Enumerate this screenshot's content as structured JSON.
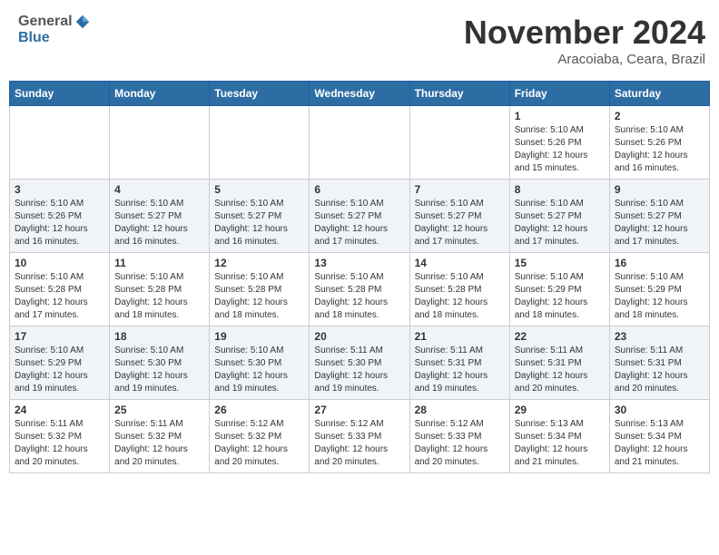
{
  "header": {
    "logo_general": "General",
    "logo_blue": "Blue",
    "month_title": "November 2024",
    "location": "Aracoiaba, Ceara, Brazil"
  },
  "weekdays": [
    "Sunday",
    "Monday",
    "Tuesday",
    "Wednesday",
    "Thursday",
    "Friday",
    "Saturday"
  ],
  "weeks": [
    [
      {
        "day": "",
        "info": ""
      },
      {
        "day": "",
        "info": ""
      },
      {
        "day": "",
        "info": ""
      },
      {
        "day": "",
        "info": ""
      },
      {
        "day": "",
        "info": ""
      },
      {
        "day": "1",
        "info": "Sunrise: 5:10 AM\nSunset: 5:26 PM\nDaylight: 12 hours\nand 15 minutes."
      },
      {
        "day": "2",
        "info": "Sunrise: 5:10 AM\nSunset: 5:26 PM\nDaylight: 12 hours\nand 16 minutes."
      }
    ],
    [
      {
        "day": "3",
        "info": "Sunrise: 5:10 AM\nSunset: 5:26 PM\nDaylight: 12 hours\nand 16 minutes."
      },
      {
        "day": "4",
        "info": "Sunrise: 5:10 AM\nSunset: 5:27 PM\nDaylight: 12 hours\nand 16 minutes."
      },
      {
        "day": "5",
        "info": "Sunrise: 5:10 AM\nSunset: 5:27 PM\nDaylight: 12 hours\nand 16 minutes."
      },
      {
        "day": "6",
        "info": "Sunrise: 5:10 AM\nSunset: 5:27 PM\nDaylight: 12 hours\nand 17 minutes."
      },
      {
        "day": "7",
        "info": "Sunrise: 5:10 AM\nSunset: 5:27 PM\nDaylight: 12 hours\nand 17 minutes."
      },
      {
        "day": "8",
        "info": "Sunrise: 5:10 AM\nSunset: 5:27 PM\nDaylight: 12 hours\nand 17 minutes."
      },
      {
        "day": "9",
        "info": "Sunrise: 5:10 AM\nSunset: 5:27 PM\nDaylight: 12 hours\nand 17 minutes."
      }
    ],
    [
      {
        "day": "10",
        "info": "Sunrise: 5:10 AM\nSunset: 5:28 PM\nDaylight: 12 hours\nand 17 minutes."
      },
      {
        "day": "11",
        "info": "Sunrise: 5:10 AM\nSunset: 5:28 PM\nDaylight: 12 hours\nand 18 minutes."
      },
      {
        "day": "12",
        "info": "Sunrise: 5:10 AM\nSunset: 5:28 PM\nDaylight: 12 hours\nand 18 minutes."
      },
      {
        "day": "13",
        "info": "Sunrise: 5:10 AM\nSunset: 5:28 PM\nDaylight: 12 hours\nand 18 minutes."
      },
      {
        "day": "14",
        "info": "Sunrise: 5:10 AM\nSunset: 5:28 PM\nDaylight: 12 hours\nand 18 minutes."
      },
      {
        "day": "15",
        "info": "Sunrise: 5:10 AM\nSunset: 5:29 PM\nDaylight: 12 hours\nand 18 minutes."
      },
      {
        "day": "16",
        "info": "Sunrise: 5:10 AM\nSunset: 5:29 PM\nDaylight: 12 hours\nand 18 minutes."
      }
    ],
    [
      {
        "day": "17",
        "info": "Sunrise: 5:10 AM\nSunset: 5:29 PM\nDaylight: 12 hours\nand 19 minutes."
      },
      {
        "day": "18",
        "info": "Sunrise: 5:10 AM\nSunset: 5:30 PM\nDaylight: 12 hours\nand 19 minutes."
      },
      {
        "day": "19",
        "info": "Sunrise: 5:10 AM\nSunset: 5:30 PM\nDaylight: 12 hours\nand 19 minutes."
      },
      {
        "day": "20",
        "info": "Sunrise: 5:11 AM\nSunset: 5:30 PM\nDaylight: 12 hours\nand 19 minutes."
      },
      {
        "day": "21",
        "info": "Sunrise: 5:11 AM\nSunset: 5:31 PM\nDaylight: 12 hours\nand 19 minutes."
      },
      {
        "day": "22",
        "info": "Sunrise: 5:11 AM\nSunset: 5:31 PM\nDaylight: 12 hours\nand 20 minutes."
      },
      {
        "day": "23",
        "info": "Sunrise: 5:11 AM\nSunset: 5:31 PM\nDaylight: 12 hours\nand 20 minutes."
      }
    ],
    [
      {
        "day": "24",
        "info": "Sunrise: 5:11 AM\nSunset: 5:32 PM\nDaylight: 12 hours\nand 20 minutes."
      },
      {
        "day": "25",
        "info": "Sunrise: 5:11 AM\nSunset: 5:32 PM\nDaylight: 12 hours\nand 20 minutes."
      },
      {
        "day": "26",
        "info": "Sunrise: 5:12 AM\nSunset: 5:32 PM\nDaylight: 12 hours\nand 20 minutes."
      },
      {
        "day": "27",
        "info": "Sunrise: 5:12 AM\nSunset: 5:33 PM\nDaylight: 12 hours\nand 20 minutes."
      },
      {
        "day": "28",
        "info": "Sunrise: 5:12 AM\nSunset: 5:33 PM\nDaylight: 12 hours\nand 20 minutes."
      },
      {
        "day": "29",
        "info": "Sunrise: 5:13 AM\nSunset: 5:34 PM\nDaylight: 12 hours\nand 21 minutes."
      },
      {
        "day": "30",
        "info": "Sunrise: 5:13 AM\nSunset: 5:34 PM\nDaylight: 12 hours\nand 21 minutes."
      }
    ]
  ]
}
